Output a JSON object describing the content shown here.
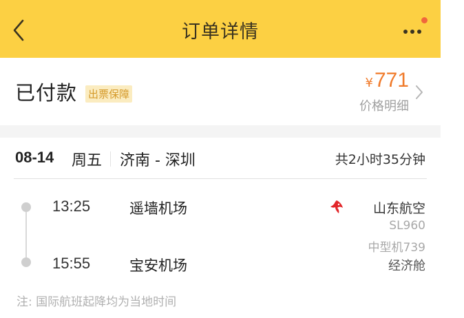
{
  "header": {
    "title": "订单详情"
  },
  "status": {
    "label": "已付款",
    "badge": "出票保障",
    "price_currency": "¥",
    "price_value": "771",
    "price_detail_label": "价格明细"
  },
  "flight": {
    "date": "08-14",
    "weekday": "周五",
    "route": "济南 - 深圳",
    "duration": "共2小时35分钟",
    "departure": {
      "time": "13:25",
      "airport": "遥墙机场"
    },
    "arrival": {
      "time": "15:55",
      "airport": "宝安机场"
    },
    "airline": "山东航空",
    "flight_no": "SL960",
    "aircraft": "中型机739",
    "cabin": "经济舱"
  },
  "note": "注: 国际航班起降均为当地时间",
  "colors": {
    "header_bg": "#fcd043",
    "price": "#f07a2a",
    "badge_bg": "#fbecc0",
    "badge_text": "#d59a2a",
    "notify_dot": "#f0663c",
    "airline_logo": "#e2262a"
  },
  "icons": {
    "back": "chevron-left-icon",
    "more": "more-dots-icon",
    "price_detail": "chevron-right-icon",
    "airline": "airline-logo-icon"
  }
}
